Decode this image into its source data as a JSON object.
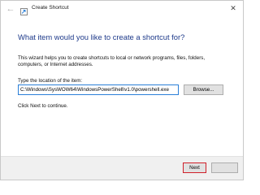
{
  "window": {
    "title": "Create Shortcut",
    "back_icon": "back-arrow-icon",
    "close_icon": "close-icon"
  },
  "main": {
    "heading": "What item would you like to create a shortcut for?",
    "description": "This wizard helps you to create shortcuts to local or network programs, files, folders, computers, or Internet addresses.",
    "location_label": "Type the location of the item:",
    "location_value": "C:\\Windows\\SysWOW64\\WindowsPowerShell\\v1.0\\powershell.exe",
    "browse_label": "Browse...",
    "hint": "Click Next to continue."
  },
  "footer": {
    "next_label": "Next",
    "next_highlight_color": "#d0202a"
  }
}
